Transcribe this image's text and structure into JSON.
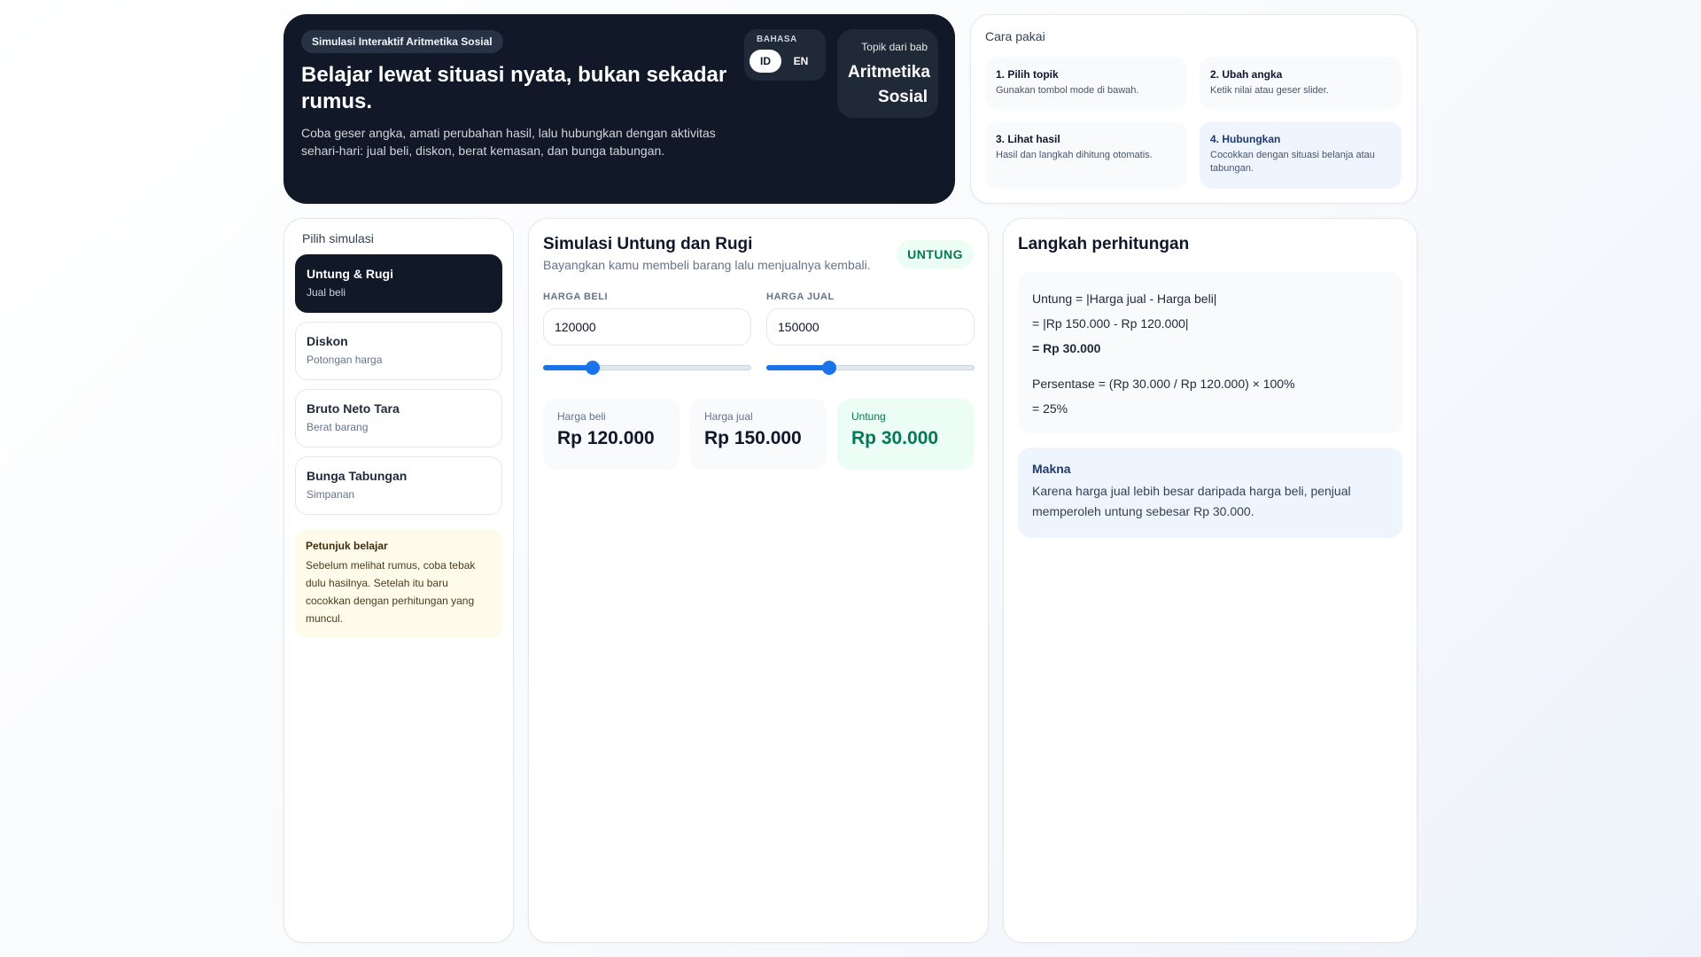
{
  "hero": {
    "badge": "Simulasi Interaktif Aritmetika Sosial",
    "title": "Belajar lewat situasi nyata, bukan sekadar rumus.",
    "description": "Coba geser angka, amati perubahan hasil, lalu hubungkan dengan aktivitas sehari-hari: jual beli, diskon, berat kemasan, dan bunga tabungan.",
    "language": {
      "label": "BAHASA",
      "options": [
        "ID",
        "EN"
      ],
      "selected": "ID"
    },
    "topic": {
      "small": "Topik dari bab",
      "big": "Aritmetika Sosial"
    }
  },
  "howto": {
    "title": "Cara pakai",
    "steps": [
      {
        "title": "1. Pilih topik",
        "desc": "Gunakan tombol mode di bawah."
      },
      {
        "title": "2. Ubah angka",
        "desc": "Ketik nilai atau geser slider."
      },
      {
        "title": "3. Lihat hasil",
        "desc": "Hasil dan langkah dihitung otomatis."
      },
      {
        "title": "4. Hubungkan",
        "desc": "Cocokkan dengan situasi belanja atau tabungan."
      }
    ]
  },
  "sidebar": {
    "title": "Pilih simulasi",
    "items": [
      {
        "title": "Untung & Rugi",
        "sub": "Jual beli"
      },
      {
        "title": "Diskon",
        "sub": "Potongan harga"
      },
      {
        "title": "Bruto Neto Tara",
        "sub": "Berat barang"
      },
      {
        "title": "Bunga Tabungan",
        "sub": "Simpanan"
      }
    ],
    "tip": {
      "title": "Petunjuk belajar",
      "text": "Sebelum melihat rumus, coba tebak dulu hasilnya. Setelah itu baru cocokkan dengan perhitungan yang muncul."
    }
  },
  "simulation": {
    "title": "Simulasi Untung dan Rugi",
    "subtitle": "Bayangkan kamu membeli barang lalu menjualnya kembali.",
    "status": "UNTUNG",
    "status_color": "#047857",
    "fields": [
      {
        "label": "HARGA BELI",
        "value": "120000",
        "slider_fraction": 0.24
      },
      {
        "label": "HARGA JUAL",
        "value": "150000",
        "slider_fraction": 0.3
      }
    ],
    "results": [
      {
        "label": "Harga beli",
        "value": "Rp 120.000"
      },
      {
        "label": "Harga jual",
        "value": "Rp 150.000"
      },
      {
        "label": "Untung",
        "value": "Rp 30.000"
      }
    ]
  },
  "calculation": {
    "title": "Langkah perhitungan",
    "lines": [
      "Untung = |Harga jual - Harga beli|",
      "= |Rp 150.000 - Rp 120.000|",
      "= Rp 30.000",
      "Persentase = (Rp 30.000 / Rp 120.000) × 100%",
      "= 25%"
    ],
    "meaning": {
      "title": "Makna",
      "text": "Karena harga jual lebih besar daripada harga beli, penjual memperoleh untung sebesar Rp 30.000."
    }
  },
  "colors": {
    "accent": "#1a73e8",
    "dark": "#111827",
    "success": "#047857"
  }
}
